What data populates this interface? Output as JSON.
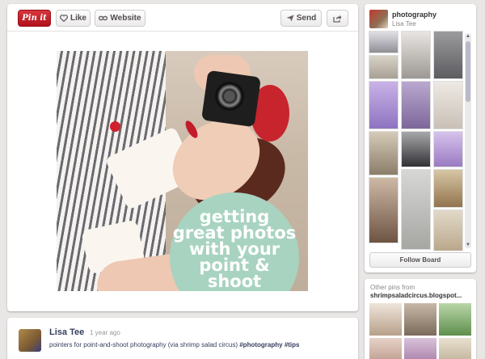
{
  "toolbar": {
    "pin_it_label": "Pin it",
    "like_label": "Like",
    "website_label": "Website",
    "send_label": "Send"
  },
  "pin_image": {
    "overlay_text": "getting\ngreat photos\nwith your\npoint & shoot",
    "accent_color": "#a8d3c1"
  },
  "comment": {
    "author": "Lisa Tee",
    "time": "1 year ago",
    "text_plain": "pointers for point-and-shoot photography (via shrimp salad circus) ",
    "tag1": "#photography",
    "tag2": "#tips"
  },
  "board": {
    "title": "photography",
    "owner": "Lisa Tee",
    "follow_label": "Follow Board"
  },
  "other_pins": {
    "label": "Other pins from",
    "source": "shrimpsaladcircus.blogspot..."
  },
  "colors": {
    "pin_red": "#c8161f",
    "link_blue": "#36405e",
    "background": "#e9e6e6"
  }
}
